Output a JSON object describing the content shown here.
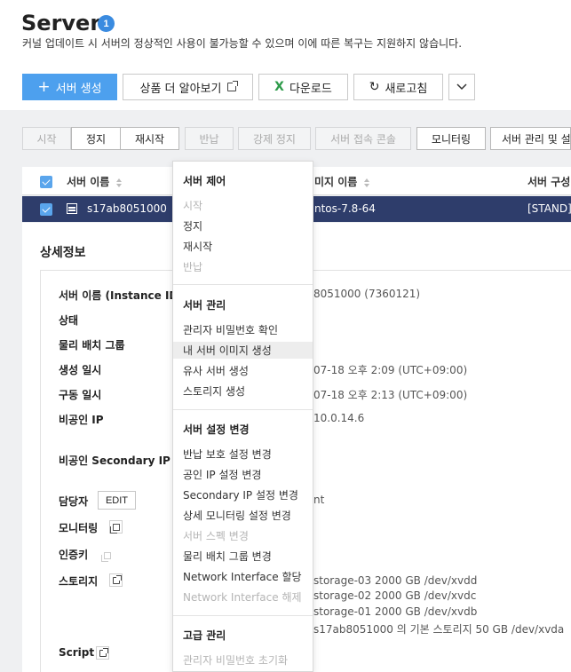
{
  "header": {
    "title": "Server",
    "badge": "1",
    "subtitle": "커널 업데이트 시 서버의 정상적인 사용이 불가능할 수 있으며 이에 따른 복구는 지원하지 않습니다."
  },
  "toolbar": {
    "create": "서버 생성",
    "learn_more": "상품 더 알아보기",
    "download": "다운로드",
    "refresh": "새로고침"
  },
  "actions": {
    "start": "시작",
    "stop": "정지",
    "restart": "재시작",
    "return": "반납",
    "force_stop": "강제 정지",
    "console": "서버 접속 콘솔",
    "monitoring": "모니터링",
    "manage": "서버 관리 및 설"
  },
  "table": {
    "col_name": "서버 이름",
    "col_image": "미지 이름",
    "col_spec": "서버 구성",
    "row": {
      "name": "s17ab8051000",
      "image": "ntos-7.8-64",
      "spec": "[STAND]"
    }
  },
  "details": {
    "title": "상세정보",
    "labels": {
      "server_name": "서버 이름 (Instance ID)",
      "status": "상태",
      "placement": "물리 배치 그룹",
      "created": "생성 일시",
      "started": "구동 일시",
      "private_ip": "비공인 IP",
      "secondary_ip": "비공인 Secondary IP",
      "owner": "담당자",
      "edit": "EDIT",
      "monitoring": "모니터링",
      "auth_key": "인증키",
      "storage": "스토리지",
      "script": "Script"
    },
    "values": {
      "server_name": "8051000 (7360121)",
      "created": "07-18 오후 2:09 (UTC+09:00)",
      "started": "07-18 오후 2:13 (UTC+09:00)",
      "private_ip": "10.0.14.6",
      "owner": "nt",
      "storage": [
        "storage-03  2000 GB /dev/xvdd",
        "storage-02  2000 GB /dev/xvdc",
        "storage-01  2000 GB /dev/xvdb",
        "s17ab8051000 의 기본 스토리지  50 GB /dev/xvda"
      ]
    }
  },
  "menu": {
    "sections": [
      {
        "title": "서버 제어",
        "items": [
          "시작",
          "정지",
          "재시작",
          "반납"
        ]
      },
      {
        "title": "서버 관리",
        "items": [
          "관리자 비밀번호 확인",
          "내 서버 이미지 생성",
          "유사 서버 생성",
          "스토리지 생성"
        ]
      },
      {
        "title": "서버 설정 변경",
        "items": [
          "반납 보호 설정 변경",
          "공인 IP 설정 변경",
          "Secondary IP 설정 변경",
          "상세 모니터링 설정 변경",
          "서버 스펙 변경",
          "물리 배치 그룹 변경",
          "Network Interface 할당",
          "Network Interface 해제"
        ]
      },
      {
        "title": "고급 관리",
        "items": [
          "관리자 비밀번호 초기화"
        ]
      }
    ]
  },
  "colors": {
    "primary": "#4da0ee",
    "selected_row": "#2e3d6b",
    "download_icon": "#2d9b4a"
  }
}
